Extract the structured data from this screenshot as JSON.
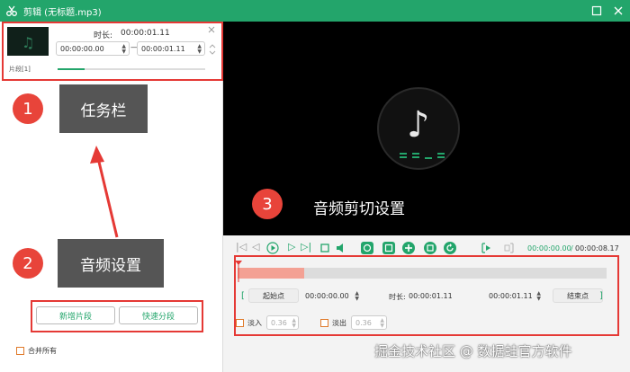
{
  "window": {
    "title": "剪辑 (无标题.mp3)"
  },
  "segment": {
    "duration_label": "时长:",
    "duration_value": "00:00:01.11",
    "start_time": "00:00:00.00",
    "dash": "—",
    "end_time": "00:00:01.11",
    "name": "片段[1]",
    "progress": 0.18
  },
  "annotations": {
    "n1": "1",
    "label1": "任务栏",
    "n2": "2",
    "label2": "音频设置",
    "n3": "3",
    "label3": "音频剪切设置"
  },
  "left_buttons": {
    "add_segment": "新增片段",
    "quick_split": "快速分段"
  },
  "merge_all": "合并所有",
  "transport": {
    "current_time": "00:00:00.00",
    "separator": "/",
    "total_time": "00:00:08.17"
  },
  "cut": {
    "bracket_open": "[",
    "start_label": "起始点",
    "start_value": "00:00:00.00",
    "duration_label": "时长:",
    "duration_value": "00:00:01.11",
    "end_value": "00:00:01.11",
    "end_label": "结束点",
    "bracket_close": "]",
    "fade_in_label": "淡入",
    "fade_in_value": "0.36",
    "fade_out_label": "淡出",
    "fade_out_value": "0.36"
  },
  "watermark": "掘金技术社区 @ 数据蛙官方软件",
  "colors": {
    "accent": "#23a56b",
    "callout_red": "#e8443a",
    "waveform_pink": "#f3a194"
  }
}
